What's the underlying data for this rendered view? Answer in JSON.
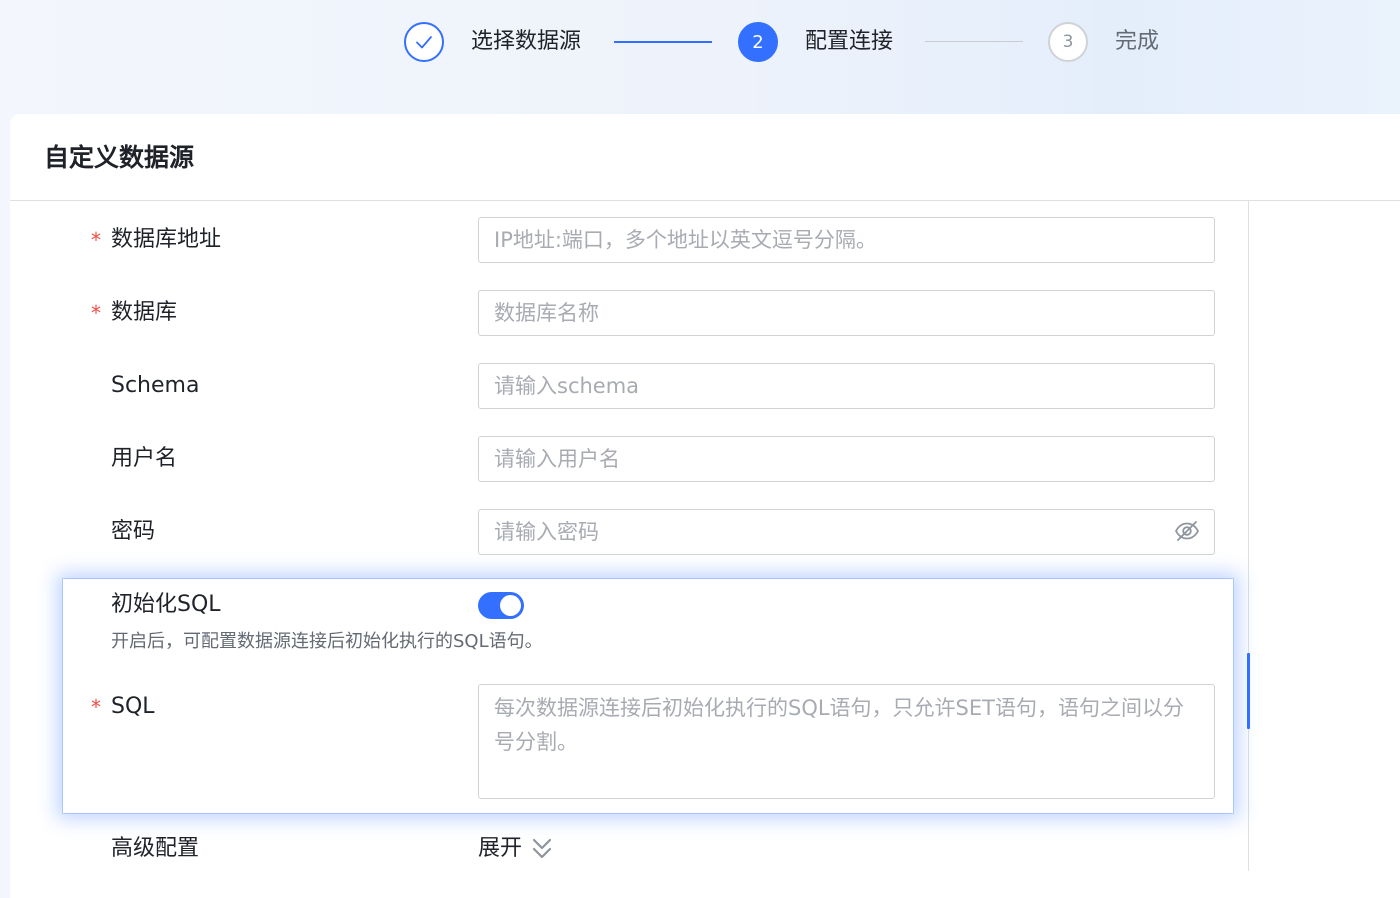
{
  "steps": [
    {
      "number": "",
      "label": "选择数据源",
      "status": "done"
    },
    {
      "number": "2",
      "label": "配置连接",
      "status": "active"
    },
    {
      "number": "3",
      "label": "完成",
      "status": "pending"
    }
  ],
  "card": {
    "title": "自定义数据源"
  },
  "form": {
    "required_mark": "*",
    "db_address": {
      "label": "数据库地址",
      "placeholder": "IP地址:端口，多个地址以英文逗号分隔。",
      "value": ""
    },
    "database": {
      "label": "数据库",
      "placeholder": "数据库名称",
      "value": ""
    },
    "schema": {
      "label": "Schema",
      "placeholder": "请输入schema",
      "value": ""
    },
    "username": {
      "label": "用户名",
      "placeholder": "请输入用户名",
      "value": ""
    },
    "password": {
      "label": "密码",
      "placeholder": "请输入密码",
      "value": "",
      "icon": "eye-off-icon"
    },
    "init_sql": {
      "label": "初始化SQL",
      "enabled": true,
      "hint": "开启后，可配置数据源连接后初始化执行的SQL语句。"
    },
    "sql": {
      "label": "SQL",
      "placeholder": "每次数据源连接后初始化执行的SQL语句，只允许SET语句，语句之间以分号分割。",
      "value": ""
    },
    "advanced": {
      "label": "高级配置",
      "expand_label": "展开",
      "icon": "double-chevron-down-icon"
    }
  },
  "colors": {
    "accent": "#3370ff",
    "required": "#f54a45",
    "placeholder": "#a8abb2",
    "border": "#d0d3d6"
  }
}
